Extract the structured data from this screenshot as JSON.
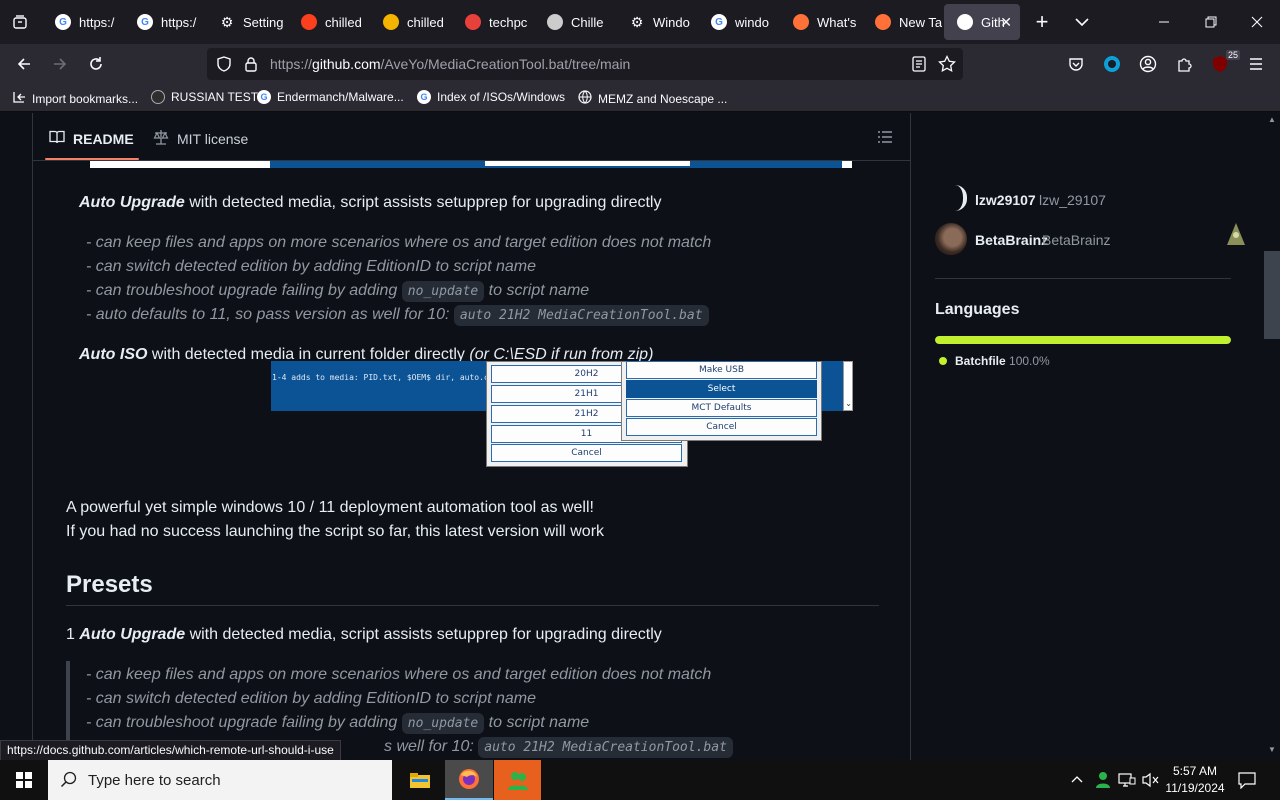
{
  "browser": {
    "tabs": [
      {
        "label": "https:/",
        "icon": "google-icon",
        "color": "#ffffff"
      },
      {
        "label": "https:/",
        "icon": "google-icon",
        "color": "#ffffff"
      },
      {
        "label": "Setting",
        "icon": "gear-icon",
        "color": "#fbfbfe"
      },
      {
        "label": "chilled",
        "icon": "yandex-icon",
        "color": "#fc3f1d"
      },
      {
        "label": "chilled",
        "icon": "image-icon",
        "color": "#f5b400"
      },
      {
        "label": "techpc",
        "icon": "techpc-icon",
        "color": "#e8413b"
      },
      {
        "label": "Chille",
        "icon": "cat-icon",
        "color": "#cccccc"
      },
      {
        "label": "Windo",
        "icon": "gear-icon",
        "color": "#fbfbfe"
      },
      {
        "label": "windo",
        "icon": "google-icon",
        "color": "#ffffff"
      },
      {
        "label": "What's",
        "icon": "firefox-icon",
        "color": "#ff7139"
      },
      {
        "label": "New Ta",
        "icon": "firefox-icon",
        "color": "#ff7139"
      },
      {
        "label": "Gith",
        "icon": "github-icon",
        "color": "#ffffff"
      }
    ],
    "url": {
      "prefix": "https://",
      "domain": "github.com",
      "path": "/AveYo/MediaCreationTool.bat/tree/main"
    },
    "extension_badge": "25",
    "bookmarks": [
      {
        "label": "Import bookmarks...",
        "icon": "import-icon"
      },
      {
        "label": "RUSSIAN TEST",
        "icon": "ghost-icon"
      },
      {
        "label": "Endermanch/Malware...",
        "icon": "google-icon"
      },
      {
        "label": "Index of /ISOs/Windows",
        "icon": "google-icon"
      },
      {
        "label": "MEMZ and Noescape ...",
        "icon": "globe-icon"
      }
    ],
    "status_url": "https://docs.github.com/articles/which-remote-url-should-i-use"
  },
  "readme": {
    "tabs": {
      "readme": "README",
      "license": "MIT license"
    },
    "section1": {
      "title_bold": "Auto Upgrade",
      "title_rest": " with detected media, script assists setupprep for upgrading directly",
      "bullets": [
        {
          "text": "- can keep files and apps on more scenarios where os and target edition does not match"
        },
        {
          "text": "- can switch detected edition by adding EditionID to script name"
        },
        {
          "text": "- can troubleshoot upgrade failing by adding ",
          "code": "no_update",
          "after": " to script name"
        },
        {
          "text": "- auto defaults to 11, so pass version as well for 10: ",
          "code": "auto 21H2 MediaCreationTool.bat"
        }
      ]
    },
    "section2": {
      "title_bold": "Auto ISO",
      "title_rest": " with detected media in current folder directly ",
      "title_it": "(or C:\\ESD if run from zip)"
    },
    "shot": {
      "line1": "1-4 adds to media: PID.txt, $OEM$ dir, auto.c",
      "versions": [
        "20H2",
        "21H1",
        "21H2",
        "11",
        "Cancel"
      ],
      "actions": [
        "Make USB",
        "Select",
        "MCT Defaults",
        "Cancel"
      ]
    },
    "intro1": "A powerful yet simple windows 10 / 11 deployment automation tool as well!",
    "intro2": "If you had no success launching the script so far, this latest version will work",
    "presets_heading": "Presets",
    "preset1": {
      "num": "1 ",
      "title_bold": "Auto Upgrade",
      "title_rest": " with detected media, script assists setupprep for upgrading directly",
      "bullets": [
        {
          "text": "- can keep files and apps on more scenarios where os and target edition does not match"
        },
        {
          "text": "- can switch detected edition by adding EditionID to script name"
        },
        {
          "text": "- can troubleshoot upgrade failing by adding ",
          "code": "no_update",
          "after": " to script name"
        },
        {
          "text": "s well for 10: ",
          "code": "auto 21H2 MediaCreationTool.bat"
        }
      ]
    }
  },
  "sidebar": {
    "contributors": [
      {
        "name": "lzw29107",
        "handle": "lzw_29107"
      },
      {
        "name": "BetaBrainz",
        "handle": "BetaBrainz"
      }
    ],
    "languages_heading": "Languages",
    "language": {
      "name": "Batchfile",
      "percent": "100.0%",
      "fraction": 1.0,
      "color": "#c1f12e"
    }
  },
  "taskbar": {
    "search_placeholder": "Type here to search",
    "time": "5:57 AM",
    "date": "11/19/2024"
  }
}
